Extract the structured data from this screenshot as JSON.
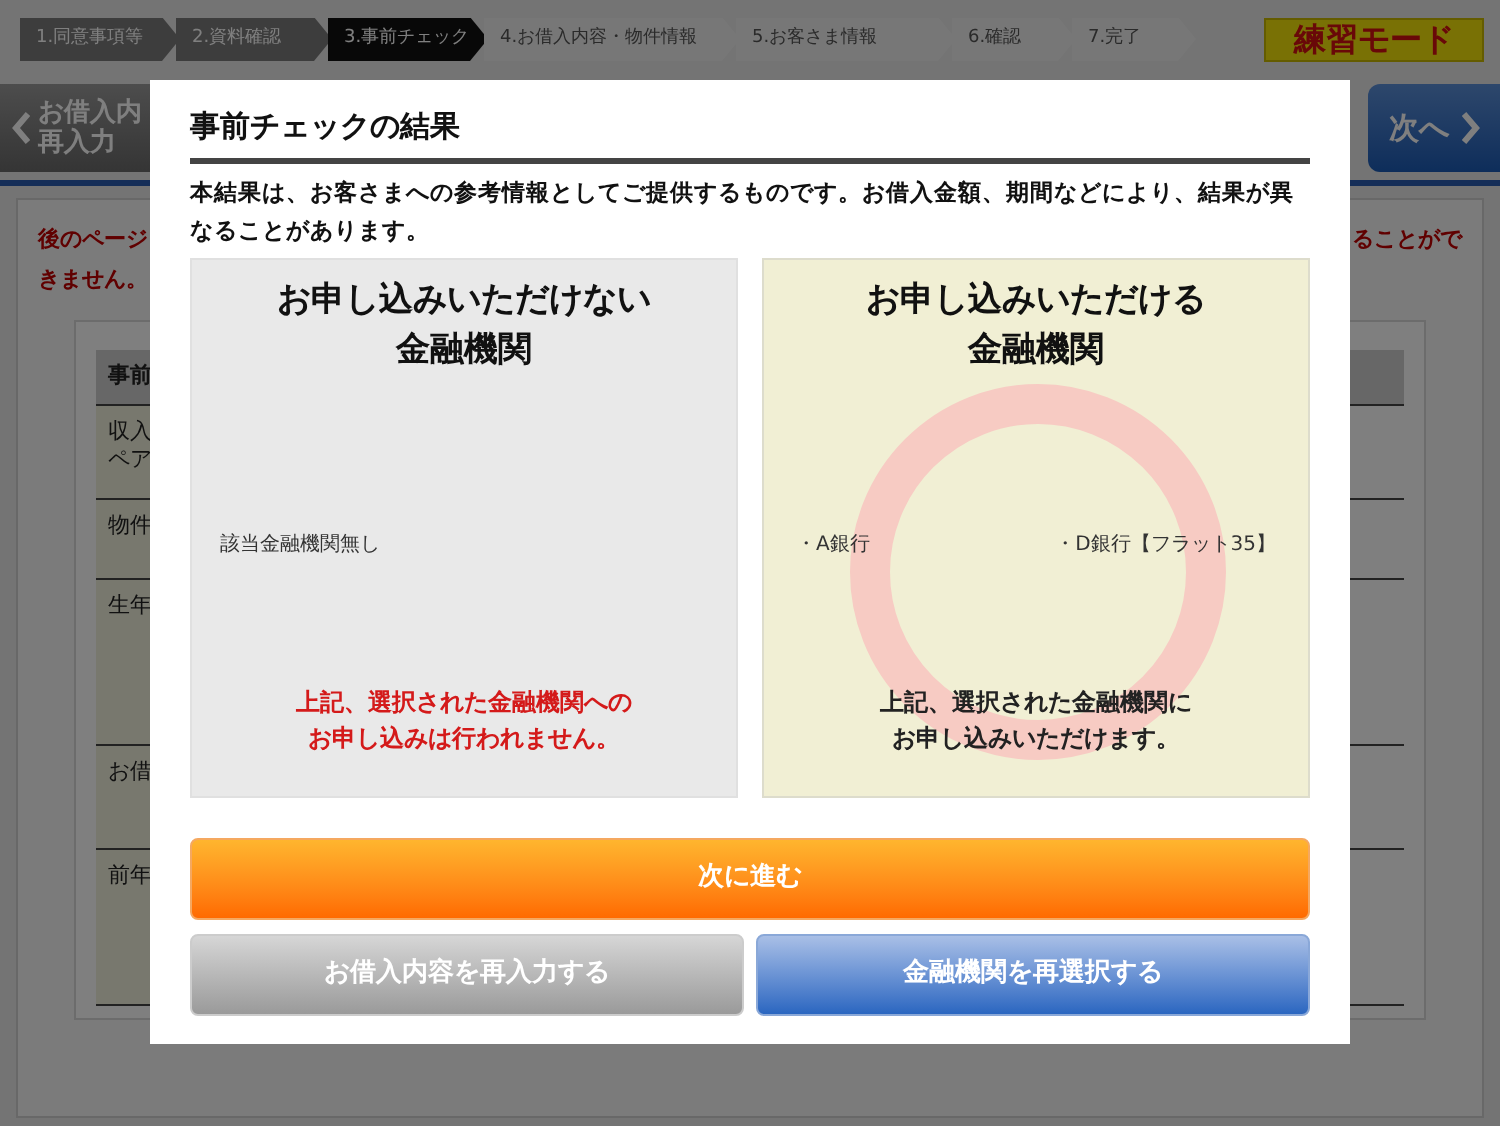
{
  "steps": [
    {
      "label": "1.同意事項等",
      "completed": true,
      "selected": false
    },
    {
      "label": "2.資料確認",
      "completed": true,
      "selected": false
    },
    {
      "label": "3.事前チェック",
      "completed": false,
      "selected": true
    },
    {
      "label": "4.お借入内容・物件情報",
      "completed": false,
      "selected": false
    },
    {
      "label": "5.お客さま情報",
      "completed": false,
      "selected": false
    },
    {
      "label": "6.確認",
      "completed": false,
      "selected": false
    },
    {
      "label": "7.完了",
      "completed": false,
      "selected": false
    }
  ],
  "mode_badge": "練習モード",
  "back_button": {
    "lines": [
      "お借入内",
      "再入力"
    ]
  },
  "next_button": "次へ",
  "notice": {
    "left_lines": [
      "後のページ",
      "きません。"
    ],
    "right": "ることがで"
  },
  "table": {
    "rows": [
      {
        "kind": "header",
        "lines": [
          "事前"
        ]
      },
      {
        "kind": "row",
        "lines": [
          "収入",
          "ペア"
        ]
      },
      {
        "kind": "row",
        "lines": [
          "物件"
        ]
      },
      {
        "kind": "row",
        "lines": [
          "生年"
        ]
      },
      {
        "kind": "row",
        "lines": [
          "お借"
        ]
      },
      {
        "kind": "row",
        "lines": [
          "前年"
        ]
      }
    ]
  },
  "dialog": {
    "title": "事前チェックの結果",
    "description": "本結果は、お客さまへの参考情報としてご提供するものです。お借入金額、期間などにより、結果が異なることがあります。",
    "panels": [
      {
        "kind": "unavailable",
        "title_lines": [
          "お申し込みいただけない",
          "金融機関"
        ],
        "items": [
          "該当金融機関無し"
        ],
        "note_lines": [
          "上記、選択された金融機関への",
          "お申し込みは行われません。"
        ]
      },
      {
        "kind": "available",
        "title_lines": [
          "お申し込みいただける",
          "金融機関"
        ],
        "items": [
          "・A銀行",
          "・D銀行【フラット35】"
        ],
        "note_lines": [
          "上記、選択された金融機関に",
          "お申し込みいただけます。"
        ]
      }
    ],
    "buttons": [
      {
        "label": "次に進む",
        "kind": "primary"
      },
      {
        "label": "お借入内容を再入力する",
        "kind": "secondary"
      },
      {
        "label": "金融機関を再選択する",
        "kind": "tertiary"
      }
    ]
  }
}
